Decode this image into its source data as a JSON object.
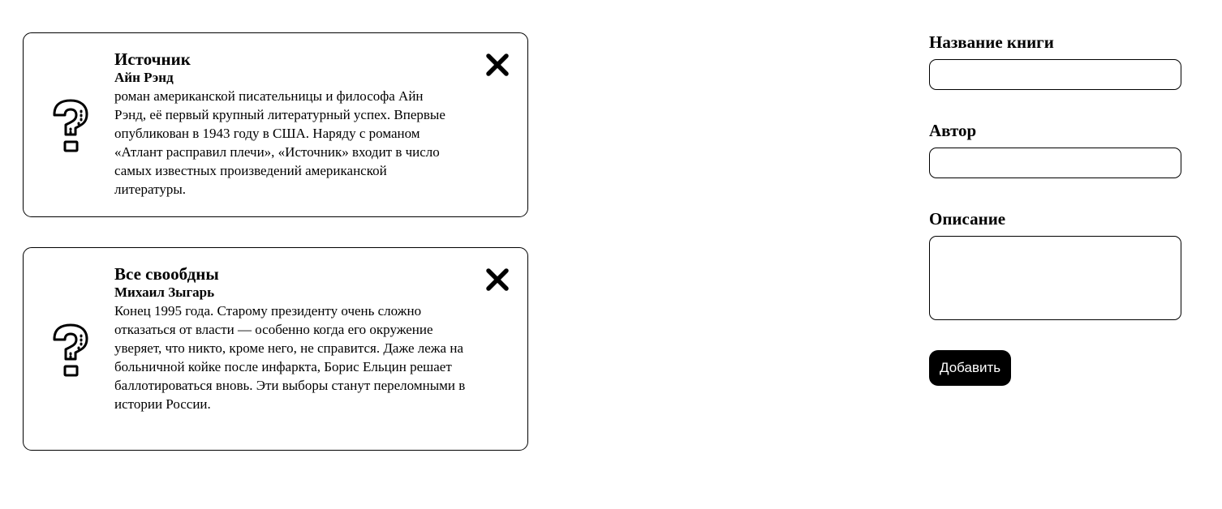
{
  "books": [
    {
      "title": "Источник",
      "author": "Айн Рэнд",
      "description": "роман американской писательницы и философа Айн Рэнд, её первый крупный литературный успех. Впервые опубликован в 1943 году в США. Наряду с романом «Атлант расправил плечи», «Источник» входит в число самых известных произведений американской литературы.",
      "cover_icon": "question-mark-icon",
      "close_icon": "close-icon"
    },
    {
      "title": "Все свообдны",
      "author": "Михаил Зыгарь",
      "description": "Конец 1995 года. Старому президенту очень сложно отказаться от власти — особенно когда его окружение уверяет, что никто, кроме него, не справится. Даже лежа на больничной койке после инфаркта, Борис Ельцин решает баллотироваться вновь. Эти выборы станут переломными в истории России.",
      "cover_icon": "question-mark-icon",
      "close_icon": "close-icon"
    }
  ],
  "form": {
    "title_label": "Название книги",
    "title_value": "",
    "author_label": "Автор",
    "author_value": "",
    "description_label": "Описание",
    "description_value": "",
    "submit_label": "Добавить"
  },
  "colors": {
    "text": "#000000",
    "background": "#ffffff",
    "button_bg": "#000000",
    "button_text": "#ffffff"
  }
}
